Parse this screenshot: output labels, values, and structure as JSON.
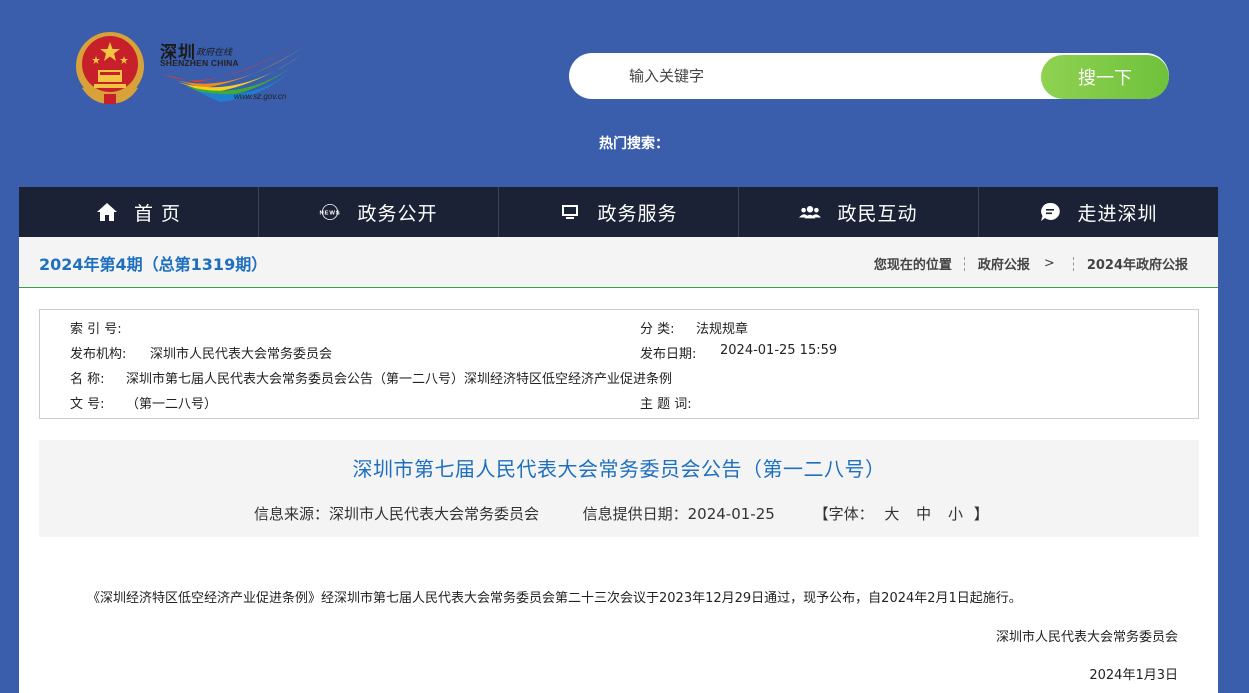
{
  "logo": {
    "title_cn": "深圳",
    "subtitle_cn": "政府在线",
    "title_en": "SHENZHEN  CHINA",
    "url": "www.sz.gov.cn"
  },
  "search": {
    "placeholder": "输入关键字",
    "button": "搜一下"
  },
  "hot_search_label": "热门搜索：",
  "nav": [
    {
      "label": "首 页",
      "icon": "home-icon"
    },
    {
      "label": "政务公开",
      "icon": "news-icon"
    },
    {
      "label": "政务服务",
      "icon": "monitor-icon"
    },
    {
      "label": "政民互动",
      "icon": "people-icon"
    },
    {
      "label": "走进深圳",
      "icon": "chat-bubble-icon"
    }
  ],
  "issue_title": "2024年第4期（总第1319期）",
  "breadcrumb": {
    "label": "您现在的位置",
    "items": [
      "政府公报",
      "2024年政府公报"
    ],
    "arrow": ">"
  },
  "meta": {
    "index_label": "索 引 号:",
    "index_value": "",
    "category_label": "分 类:",
    "category_value": "法规规章",
    "publisher_label": "发布机构:",
    "publisher_value": "深圳市人民代表大会常务委员会",
    "date_label": "发布日期:",
    "date_value": "2024-01-25 15:59",
    "name_label": "名 称:",
    "name_value": "深圳市第七届人民代表大会常务委员会公告（第一二八号）深圳经济特区低空经济产业促进条例",
    "docno_label": "文 号:",
    "docno_value": "（第一二八号）",
    "keyword_label": "主 题 词:",
    "keyword_value": ""
  },
  "document": {
    "title": "深圳市第七届人民代表大会常务委员会公告（第一二八号）",
    "source_label": "信息来源：",
    "source_value": "深圳市人民代表大会常务委员会",
    "date_label": "信息提供日期：",
    "date_value": "2024-01-25",
    "font_label_open": "【字体：",
    "font_sizes": [
      "大",
      "中",
      "小"
    ],
    "font_label_close": "】",
    "body": "《深圳经济特区低空经济产业促进条例》经深圳市第七届人民代表大会常务委员会第二十三次会议于2023年12月29日通过，现予公布，自2024年2月1日起施行。",
    "signature": "深圳市人民代表大会常务委员会",
    "sign_date": "2024年1月3日"
  }
}
